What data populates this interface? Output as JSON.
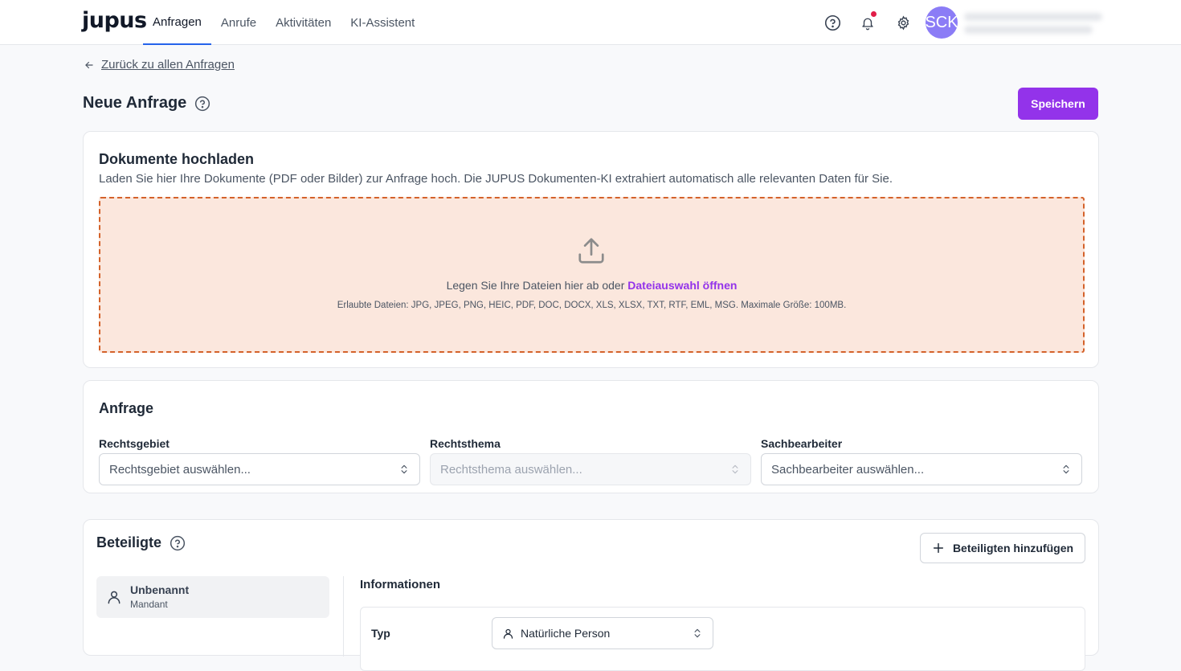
{
  "app": {
    "logo": "jupus"
  },
  "nav": {
    "items": [
      {
        "label": "Anfragen",
        "active": true
      },
      {
        "label": "Anrufe"
      },
      {
        "label": "Aktivitäten"
      },
      {
        "label": "KI-Assistent"
      }
    ]
  },
  "user": {
    "initials": "SCK"
  },
  "back_link": "Zurück zu allen Anfragen",
  "page": {
    "title": "Neue Anfrage",
    "save_label": "Speichern"
  },
  "upload": {
    "title": "Dokumente hochladen",
    "description": "Laden Sie hier Ihre Dokumente (PDF oder Bilder) zur Anfrage hoch. Die JUPUS Dokumenten-KI extrahiert automatisch alle relevanten Daten für Sie.",
    "drop_text": "Legen Sie Ihre Dateien hier ab oder",
    "browse_link": "Dateiauswahl öffnen",
    "allowed": "Erlaubte Dateien: JPG, JPEG, PNG, HEIC, PDF, DOC, DOCX, XLS, XLSX, TXT, RTF, EML, MSG. Maximale Größe: 100MB."
  },
  "request": {
    "title": "Anfrage",
    "fields": [
      {
        "label": "Rechtsgebiet",
        "placeholder": "Rechtsgebiet auswählen...",
        "disabled": false
      },
      {
        "label": "Rechtsthema",
        "placeholder": "Rechtsthema auswählen...",
        "disabled": true
      },
      {
        "label": "Sachbearbeiter",
        "placeholder": "Sachbearbeiter auswählen...",
        "disabled": false
      }
    ]
  },
  "parties": {
    "title": "Beteiligte",
    "add_label": "Beteiligten hinzufügen",
    "list": [
      {
        "name": "Unbenannt",
        "role": "Mandant"
      }
    ],
    "info_title": "Informationen",
    "type_label": "Typ",
    "type_value": "Natürliche Person"
  },
  "colors": {
    "accent": "#9333ea",
    "dropzone_bg": "#fbe7dd",
    "dropzone_border": "#d4622a",
    "avatar": "#8b7cf6",
    "nav_active": "#2563eb",
    "notification": "#e11d48"
  }
}
